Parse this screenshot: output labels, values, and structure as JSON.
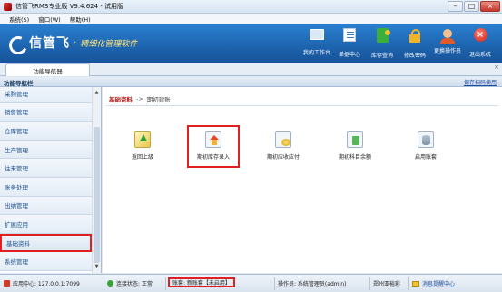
{
  "window": {
    "title": "信管飞RMS专业版 V9.4.624 - 试用版",
    "minimize": "–",
    "maximize": "□",
    "close": "×"
  },
  "menu": [
    "系统(S)",
    "窗口(W)",
    "帮助(H)"
  ],
  "brand": {
    "name": "信管飞",
    "dot": "·",
    "tagline": "精细化管理软件"
  },
  "toolbar": [
    {
      "label": "我的工作台",
      "icon": "monitor-icon"
    },
    {
      "label": "单据中心",
      "icon": "document-list-icon"
    },
    {
      "label": "库存查询",
      "icon": "inventory-book-icon"
    },
    {
      "label": "修改密码",
      "icon": "lock-icon"
    },
    {
      "label": "更换操作员",
      "icon": "user-icon"
    },
    {
      "label": "退出系统",
      "icon": "exit-icon"
    }
  ],
  "tabs": [
    {
      "label": "功能导航器",
      "close": "×"
    }
  ],
  "nav_header": {
    "title": "功能导航栏",
    "link": "保存扫码使用"
  },
  "sidebar": {
    "items": [
      "采购管理",
      "销售管理",
      "仓库管理",
      "生产管理",
      "往来管理",
      "账务处理",
      "出纳管理",
      "扩展应用",
      "基础资料",
      "系统管理"
    ],
    "active_index": 8,
    "scroll_up": "▲",
    "scroll_down": "▼"
  },
  "breadcrumb": {
    "root": "基础资料",
    "sep": "->",
    "current": "期初建账"
  },
  "tiles": [
    {
      "label": "返回上级",
      "icon": "up-arrow-icon"
    },
    {
      "label": "期初库存录入",
      "icon": "warehouse-home-icon",
      "selected": true
    },
    {
      "label": "期初应收应付",
      "icon": "coins-icon"
    },
    {
      "label": "期初科目余额",
      "icon": "ledger-doc-icon"
    },
    {
      "label": "启用账套",
      "icon": "database-icon"
    }
  ],
  "status": {
    "app_center": "应用中心: 127.0.0.1:7099",
    "connection": "连接状态: 正常",
    "account": "账套: 新账套【未启用】",
    "operator": "操作员: 系统管理员(admin)",
    "location": "郑州亚裕彩",
    "message": "消息提醒中心"
  }
}
